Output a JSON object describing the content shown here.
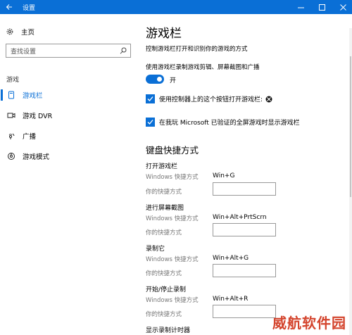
{
  "window": {
    "title": "设置"
  },
  "sidebar": {
    "home_label": "主页",
    "search_placeholder": "查找设置",
    "section_label": "游戏",
    "items": [
      {
        "label": "游戏栏",
        "icon": "game-bar-icon",
        "active": true
      },
      {
        "label": "游戏 DVR",
        "icon": "game-dvr-icon",
        "active": false
      },
      {
        "label": "广播",
        "icon": "broadcast-icon",
        "active": false
      },
      {
        "label": "游戏模式",
        "icon": "game-mode-icon",
        "active": false
      }
    ]
  },
  "main": {
    "title": "游戏栏",
    "description": "控制游戏栏打开和识别你的游戏的方式",
    "toggle_label": "使用游戏栏录制游戏剪辑、屏幕截图和广播",
    "toggle_state": "开",
    "checkbox1_label": "使用控制器上的这个按钮打开游戏栏:",
    "checkbox2_label": "在我玩 Microsoft 已验证的全屏游戏时显示游戏栏",
    "shortcuts_title": "键盘快捷方式",
    "windows_shortcut_label": "Windows 快捷方式",
    "your_shortcut_label": "你的快捷方式",
    "groups": [
      {
        "title": "打开游戏栏",
        "windows_shortcut": "Win+G"
      },
      {
        "title": "进行屏幕截图",
        "windows_shortcut": "Win+Alt+PrtScrn"
      },
      {
        "title": "录制它",
        "windows_shortcut": "Win+Alt+G"
      },
      {
        "title": "开始/停止录制",
        "windows_shortcut": "Win+Alt+R"
      },
      {
        "title": "显示录制计时器",
        "windows_shortcut": ""
      }
    ]
  },
  "colors": {
    "accent": "#0a6fd6",
    "watermark": "#d4452e"
  },
  "watermark": "威航软件园"
}
